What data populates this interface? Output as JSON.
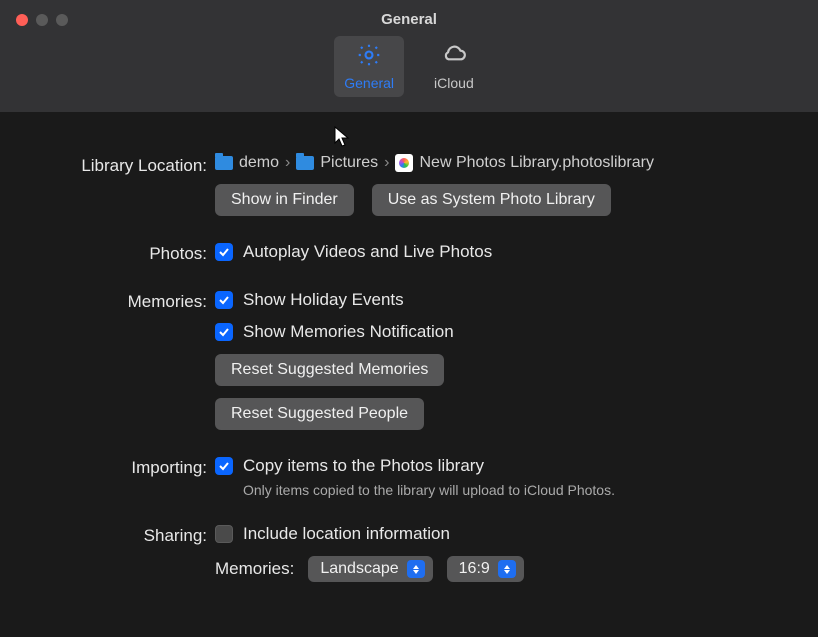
{
  "window_title": "General",
  "tabs": {
    "general": "General",
    "icloud": "iCloud"
  },
  "library": {
    "label": "Library Location:",
    "path": {
      "seg1": "demo",
      "seg2": "Pictures",
      "seg3": "New Photos Library.photoslibrary"
    },
    "show_in_finder": "Show in Finder",
    "use_as_system": "Use as System Photo Library"
  },
  "photos": {
    "label": "Photos:",
    "autoplay": "Autoplay Videos and Live Photos"
  },
  "memories": {
    "label": "Memories:",
    "holiday": "Show Holiday Events",
    "notification": "Show Memories Notification",
    "reset_memories": "Reset Suggested Memories",
    "reset_people": "Reset Suggested People"
  },
  "importing": {
    "label": "Importing:",
    "copy": "Copy items to the Photos library",
    "note": "Only items copied to the library will upload to iCloud Photos."
  },
  "sharing": {
    "label": "Sharing:",
    "include_location": "Include location information",
    "memories_label": "Memories:",
    "orientation": "Landscape",
    "aspect": "16:9"
  }
}
